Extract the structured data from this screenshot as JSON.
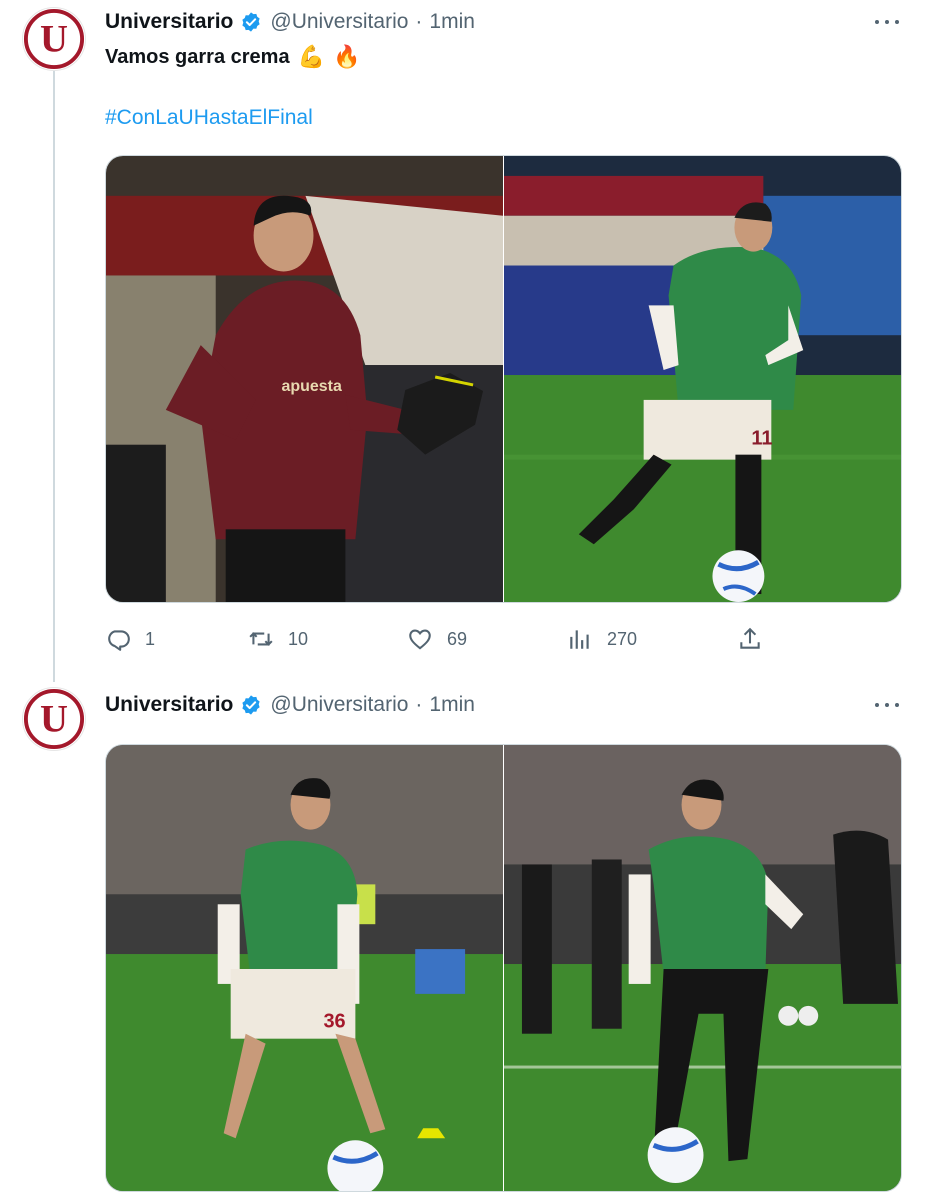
{
  "tweets": [
    {
      "author": {
        "name": "Universitario",
        "handle": "@Universitario",
        "time": "1min",
        "separator": "·",
        "avatar_letter": "U",
        "verified": true
      },
      "text": "Vamos garra crema",
      "emojis": [
        "💪",
        "🔥"
      ],
      "hashtag": "#ConLaUHastaElFinal",
      "media": [
        {
          "icon": "photo-goalkeeper",
          "jersey_text": "apuesta"
        },
        {
          "icon": "photo-player-11",
          "jersey_number": "11"
        }
      ],
      "stats": {
        "replies": "1",
        "retweets": "10",
        "likes": "69",
        "views": "270"
      }
    },
    {
      "author": {
        "name": "Universitario",
        "handle": "@Universitario",
        "time": "1min",
        "separator": "·",
        "avatar_letter": "U",
        "verified": true
      },
      "media": [
        {
          "icon": "photo-player-36",
          "jersey_number": "36"
        },
        {
          "icon": "photo-player-training"
        }
      ]
    }
  ],
  "colors": {
    "brand_red": "#a4182b",
    "verified_blue": "#1d9bf0",
    "link_blue": "#1d9bf0",
    "muted_gray": "#536471",
    "pitch_green": "#3f8a2e"
  },
  "icons": [
    "more-icon",
    "verified-icon",
    "reply-icon",
    "retweet-icon",
    "like-icon",
    "views-icon",
    "share-icon"
  ]
}
